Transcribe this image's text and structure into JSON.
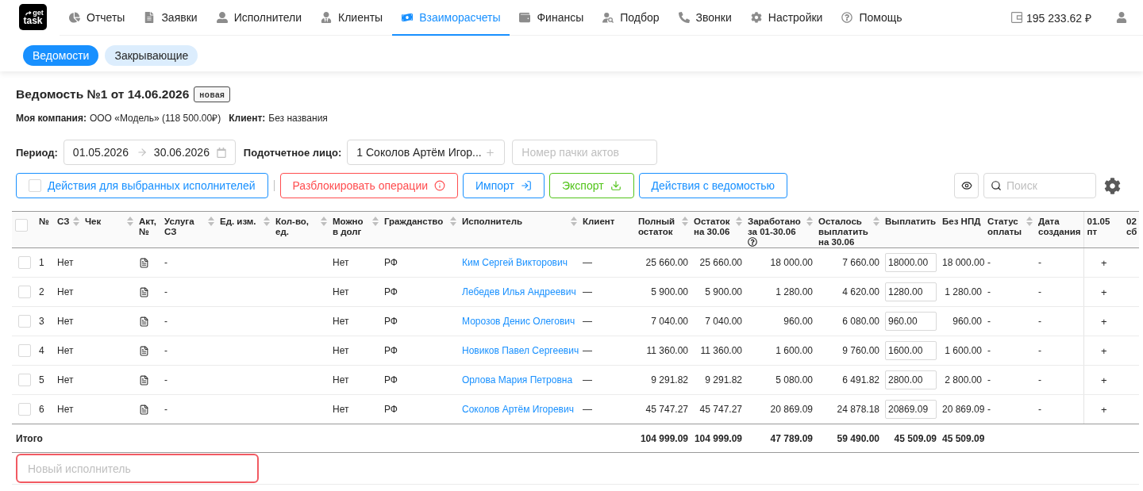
{
  "logo": {
    "line_1": "get",
    "line_2": "task"
  },
  "nav": [
    {
      "label": "Отчеты",
      "selected": false
    },
    {
      "label": "Заявки",
      "selected": false
    },
    {
      "label": "Исполнители",
      "selected": false
    },
    {
      "label": "Клиенты",
      "selected": false
    },
    {
      "label": "Взаиморасчеты",
      "selected": true
    },
    {
      "label": "Финансы",
      "selected": false
    },
    {
      "label": "Подбор",
      "selected": false
    },
    {
      "label": "Звонки",
      "selected": false
    },
    {
      "label": "Настройки",
      "selected": false
    },
    {
      "label": "Помощь",
      "selected": false
    }
  ],
  "balance": "195 233.62 ₽",
  "subtabs": [
    {
      "label": "Ведомости",
      "selected": true
    },
    {
      "label": "Закрывающие",
      "selected": false
    }
  ],
  "statement": {
    "title": "Ведомость №1 от 14.06.2026",
    "status": "новая",
    "company_label": "Моя компания:",
    "company_value": "ООО «Модель» (118 500.00₽)",
    "client_label": "Клиент:",
    "client_value": "Без названия"
  },
  "filters": {
    "period_label": "Период:",
    "date_from": "01.05.2026",
    "date_to": "30.06.2026",
    "person_label": "Подотчетное лицо:",
    "person_value": "1 Соколов Артём Игор...",
    "pack_placeholder": "Номер пачки актов"
  },
  "actions": [
    {
      "kind": "bulk",
      "label": "Действия для выбранных исполнителей",
      "checked": false
    },
    {
      "kind": "danger",
      "label": "Разблокировать операции"
    },
    {
      "kind": "import",
      "label": "Импорт"
    },
    {
      "kind": "export",
      "label": "Экспорт"
    },
    {
      "kind": "plain",
      "label": "Действия с ведомостью"
    }
  ],
  "search": {
    "placeholder": "Поиск"
  },
  "table": {
    "select_all_checked": false,
    "columns": [
      {
        "label": "№",
        "sortable": false
      },
      {
        "label": "СЗ",
        "sortable": true
      },
      {
        "label": "Чек",
        "sortable": true
      },
      {
        "label": "Акт, №",
        "sortable": false
      },
      {
        "label": "Услуга СЗ",
        "sortable": true
      },
      {
        "label": "Ед. изм.",
        "sortable": true
      },
      {
        "label": "Кол-во, ед.",
        "sortable": true
      },
      {
        "label": "Можно в долг",
        "sortable": true
      },
      {
        "label": "Гражданство",
        "sortable": true
      },
      {
        "label": "Исполнитель",
        "sortable": true
      },
      {
        "label": "Клиент",
        "sortable": false
      },
      {
        "label": "Полный остаток",
        "sortable": true
      },
      {
        "label": "Остаток на 30.06",
        "sortable": true
      },
      {
        "label": "Заработано за 01-30.06",
        "sortable": true,
        "help": true
      },
      {
        "label": "Осталось выплатить на 30.06",
        "sortable": true
      },
      {
        "label": "Выплатить",
        "sortable": false
      },
      {
        "label": "Без НПД",
        "sortable": false
      },
      {
        "label": "Статус оплаты",
        "sortable": true
      },
      {
        "label": "Дата создания",
        "sortable": false
      },
      {
        "label": "01.05 пт",
        "sortable": false
      },
      {
        "label": "02 сб",
        "sortable": false
      }
    ],
    "rows": [
      {
        "number": "1",
        "checked": false,
        "sz": "Нет",
        "service": "-",
        "debt": "Нет",
        "citizenship": "РФ",
        "name": "Ким Сергей Викторович",
        "client": "—",
        "full_balance": "25 660.00",
        "balance": "25 660.00",
        "earned": "18 000.00",
        "remaining": "7 660.00",
        "pay": "18000.00",
        "no_npd": "18 000.00",
        "status": "-",
        "created": "-",
        "day_1": "+"
      },
      {
        "number": "2",
        "checked": false,
        "sz": "Нет",
        "service": "-",
        "debt": "Нет",
        "citizenship": "РФ",
        "name": "Лебедев Илья Андреевич",
        "client": "—",
        "full_balance": "5 900.00",
        "balance": "5 900.00",
        "earned": "1 280.00",
        "remaining": "4 620.00",
        "pay": "1280.00",
        "no_npd": "1 280.00",
        "status": "-",
        "created": "-",
        "day_1": "+"
      },
      {
        "number": "3",
        "checked": false,
        "sz": "Нет",
        "service": "-",
        "debt": "Нет",
        "citizenship": "РФ",
        "name": "Морозов Денис Олегович",
        "client": "—",
        "full_balance": "7 040.00",
        "balance": "7 040.00",
        "earned": "960.00",
        "remaining": "6 080.00",
        "pay": "960.00",
        "no_npd": "960.00",
        "status": "-",
        "created": "-",
        "day_1": "+"
      },
      {
        "number": "4",
        "checked": false,
        "sz": "Нет",
        "service": "-",
        "debt": "Нет",
        "citizenship": "РФ",
        "name": "Новиков Павел Сергеевич",
        "client": "—",
        "full_balance": "11 360.00",
        "balance": "11 360.00",
        "earned": "1 600.00",
        "remaining": "9 760.00",
        "pay": "1600.00",
        "no_npd": "1 600.00",
        "status": "-",
        "created": "-",
        "day_1": "+"
      },
      {
        "number": "5",
        "checked": false,
        "sz": "Нет",
        "service": "-",
        "debt": "Нет",
        "citizenship": "РФ",
        "name": "Орлова Мария Петровна",
        "client": "—",
        "full_balance": "9 291.82",
        "balance": "9 291.82",
        "earned": "5 080.00",
        "remaining": "6 491.82",
        "pay": "2800.00",
        "no_npd": "2 800.00",
        "status": "-",
        "created": "-",
        "day_1": "+"
      },
      {
        "number": "6",
        "checked": false,
        "sz": "Нет",
        "service": "-",
        "debt": "Нет",
        "citizenship": "РФ",
        "name": "Соколов Артём Игоревич",
        "client": "—",
        "full_balance": "45 747.27",
        "balance": "45 747.27",
        "earned": "20 869.09",
        "remaining": "24 878.18",
        "pay": "20869.09",
        "no_npd": "20 869.09",
        "status": "-",
        "created": "-",
        "day_1": "+"
      }
    ],
    "totals": {
      "label": "Итого",
      "full_balance": "104 999.09",
      "balance": "104 999.09",
      "earned": "47 789.09",
      "remaining": "59 490.00",
      "pay": "45 509.09",
      "no_npd": "45 509.09"
    },
    "new_row_placeholder": "Новый исполнитель"
  }
}
